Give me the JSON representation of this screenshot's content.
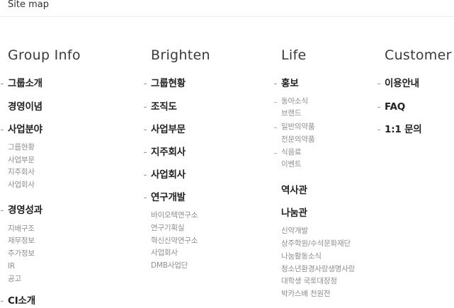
{
  "header": {
    "title": "Site map"
  },
  "columns": {
    "group_info": {
      "heading": "Group Info",
      "items": {
        "intro": "그룹소개",
        "philosophy": "경영이념",
        "business": "사업분야",
        "business_subs": [
          "그룹현황",
          "사업부문",
          "지주회사",
          "사업회사"
        ],
        "performance": "경영성과",
        "performance_subs": [
          "지배구조",
          "재무정보",
          "주가정보",
          "IR",
          "공고"
        ],
        "ci": "CI소개"
      }
    },
    "brighten": {
      "heading": "Brighten",
      "items": {
        "status": "그룹현황",
        "org": "조직도",
        "division": "사업부문",
        "holding": "지주회사",
        "company": "사업회사",
        "rnd": "연구개발",
        "rnd_subs": [
          "바이오텍연구소",
          "연구기획실",
          "혁신신약연구소",
          "사업회사",
          "DMB사업단"
        ]
      }
    },
    "life": {
      "heading": "Life",
      "items": {
        "pr": "홍보",
        "pr_subs": [
          "동아소식",
          "브랜드",
          "일반의약품",
          "전문의약품",
          "식음료",
          "이벤트"
        ],
        "history": "역사관",
        "sharing": "나눔관",
        "sharing_subs": [
          "신약개발",
          "상주학원/수석문화재단",
          "나눔활동소식",
          "청소년환경사랑생명사랑",
          "대학생 국토대장정",
          "박카스배 천원전"
        ]
      }
    },
    "customer": {
      "heading": "Customer",
      "items": {
        "guide": "이용안내",
        "faq": "FAQ",
        "inquiry": "1:1 문의"
      }
    }
  }
}
